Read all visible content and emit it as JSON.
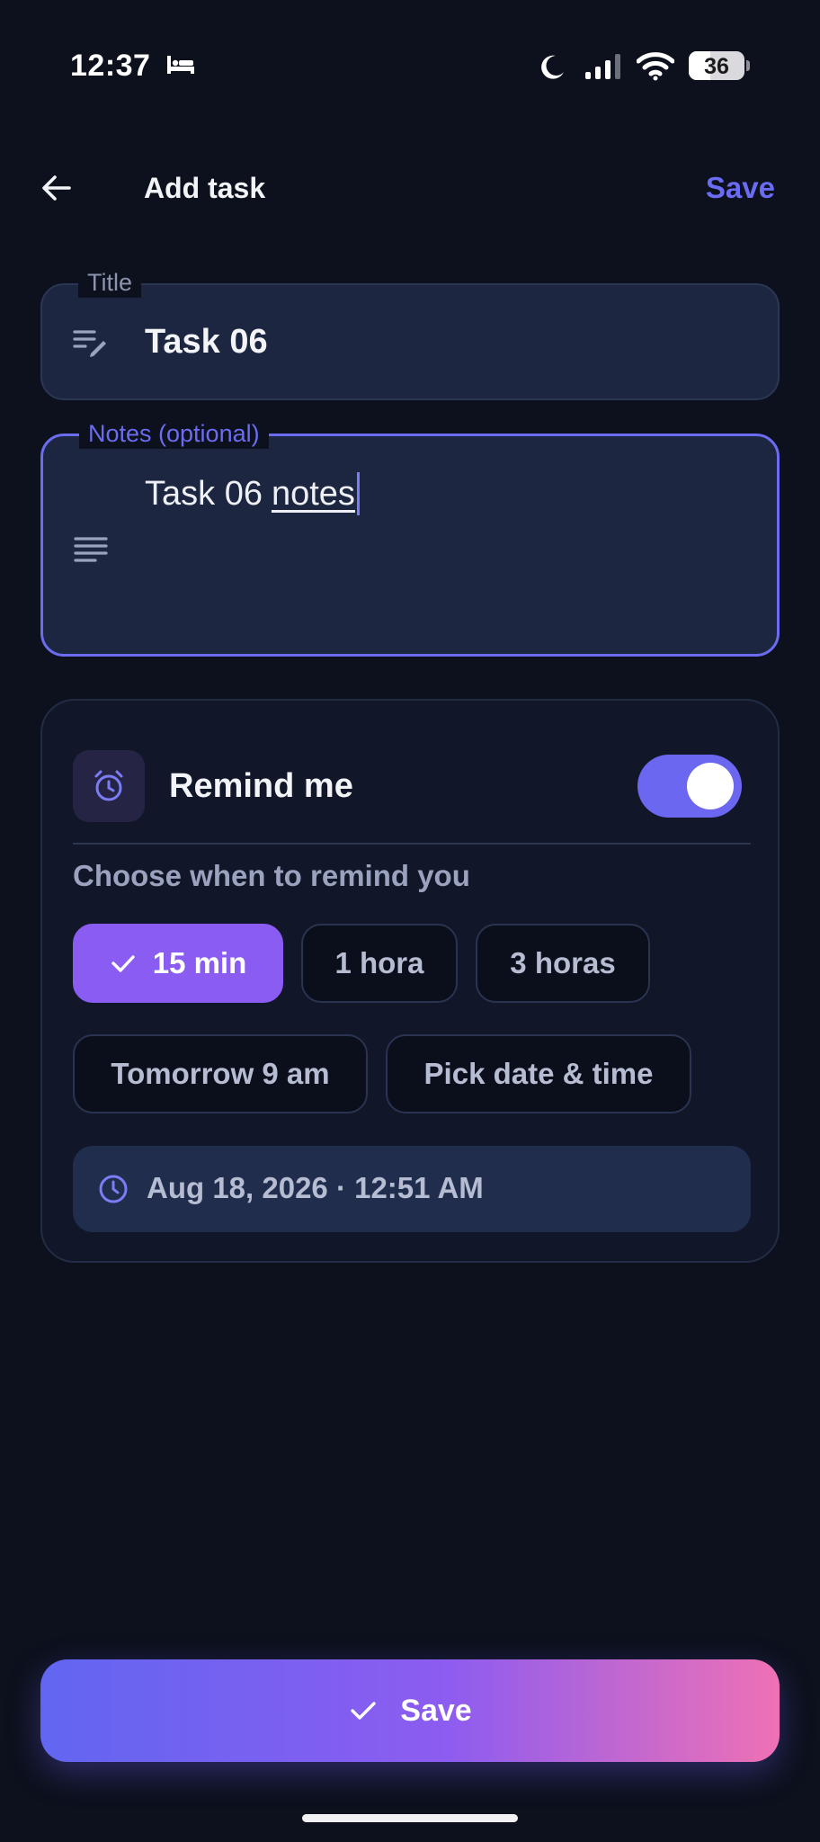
{
  "status_bar": {
    "time": "12:37",
    "battery_level": "36",
    "icons": [
      "bed-icon",
      "moon-icon",
      "signal-icon",
      "wifi-icon",
      "battery-icon"
    ]
  },
  "app_bar": {
    "back_icon": "arrow-left-icon",
    "title": "Add task",
    "save_label": "Save",
    "accent_color": "#6a6cf3"
  },
  "form": {
    "title_field": {
      "label": "Title",
      "value": "Task 06",
      "icon": "edit-lines-icon"
    },
    "notes_field": {
      "label": "Notes (optional)",
      "value_prefix": "Task 06",
      "value_suffix": "notes",
      "icon": "notes-lines-icon",
      "focused": true
    }
  },
  "reminder": {
    "icon": "alarm-icon",
    "label": "Remind me",
    "enabled": true,
    "choose_label": "Choose when to remind you",
    "options": [
      {
        "label": "15 min",
        "selected": true
      },
      {
        "label": "1 hora",
        "selected": false
      },
      {
        "label": "3 horas",
        "selected": false
      },
      {
        "label": "Tomorrow 9 am",
        "selected": false
      },
      {
        "label": "Pick date & time",
        "selected": false
      }
    ],
    "selected_datetime": "Aug 18, 2026 · 12:51 AM",
    "selected_color": "#8a5cf2"
  },
  "footer": {
    "save_label": "Save",
    "gradient": [
      "#6166f1",
      "#8d5cf0",
      "#ef71b5"
    ]
  }
}
